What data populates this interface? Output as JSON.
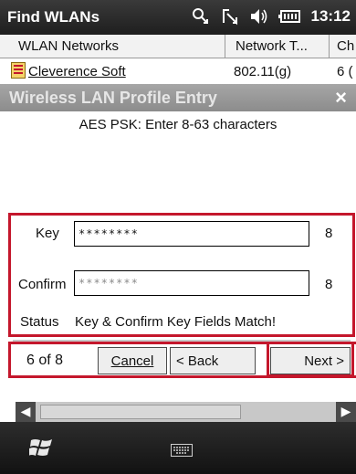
{
  "status_bar": {
    "app_title": "Find WLANs",
    "time": "13:12",
    "icons": [
      "connectivity-icon",
      "signal-icon",
      "volume-icon",
      "battery-icon"
    ]
  },
  "list": {
    "columns": [
      "WLAN Networks",
      "Network T...",
      "Ch"
    ],
    "rows": [
      {
        "name": "Cleverence Soft",
        "type": "802.11(g)",
        "channel": "6 ("
      }
    ]
  },
  "dialog": {
    "title": "Wireless LAN Profile Entry",
    "close": "×",
    "hint": "AES PSK: Enter 8-63 characters",
    "key_label": "Key",
    "key_value": "********",
    "key_count": "8",
    "confirm_label": "Confirm",
    "confirm_value": "********",
    "confirm_count": "8",
    "status_label": "Status",
    "status_text": "Key & Confirm Key Fields Match!"
  },
  "buttons": {
    "page": "6 of 8",
    "cancel": "Cancel",
    "back": "< Back",
    "next": "Next >"
  },
  "colors": {
    "highlight": "#c4172c",
    "title_bar": "#8c8c8c",
    "taskbar": "#1e1e1e"
  }
}
